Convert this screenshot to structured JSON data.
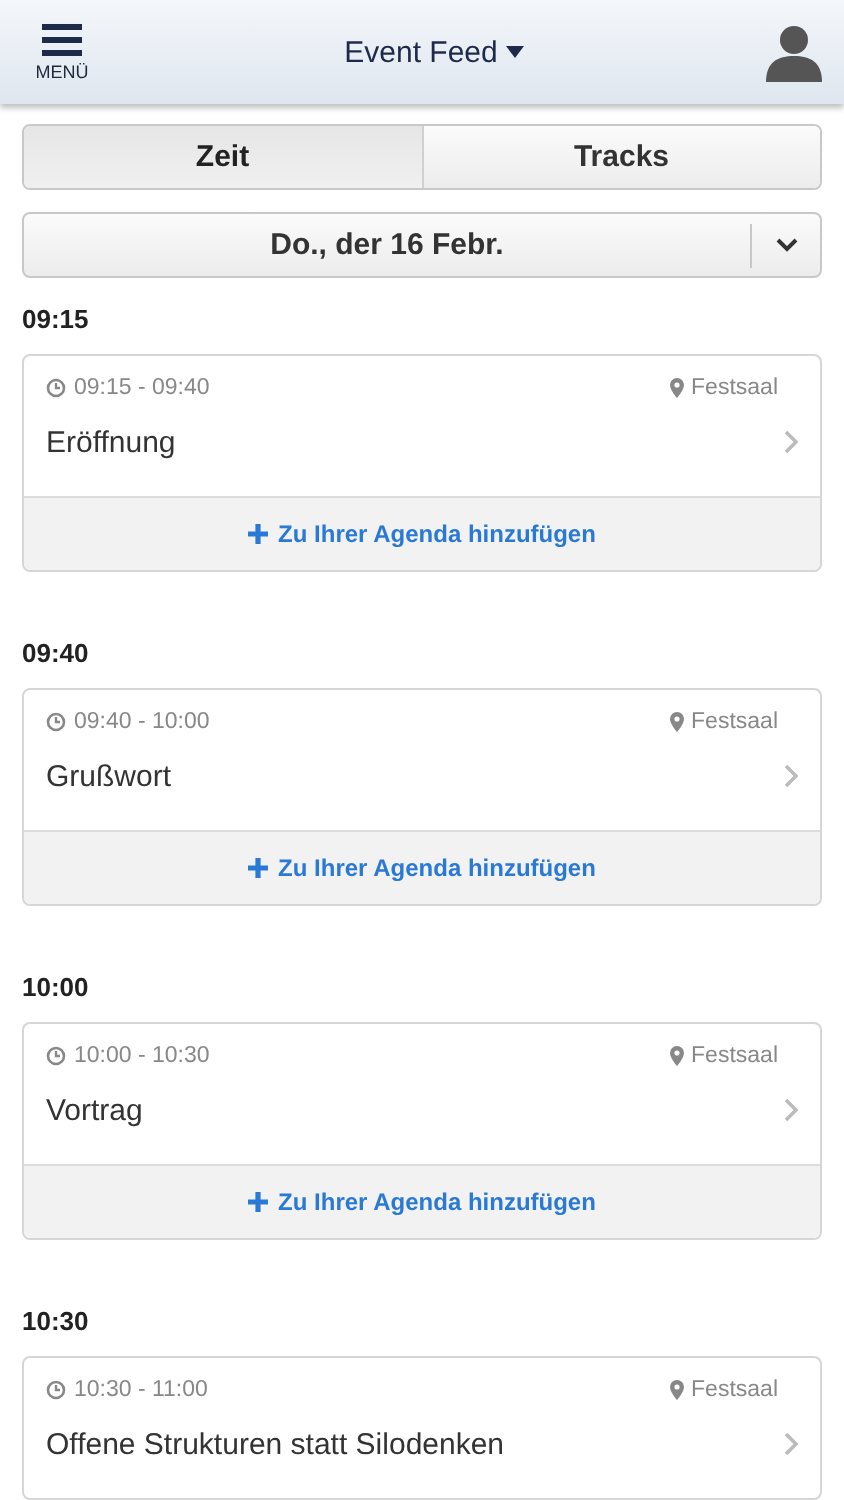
{
  "header": {
    "menu_label": "MENÜ",
    "title": "Event Feed"
  },
  "tabs": [
    {
      "label": "Zeit",
      "selected": true
    },
    {
      "label": "Tracks",
      "selected": false
    }
  ],
  "date_picker": {
    "value": "Do., der 16 Febr."
  },
  "slots": [
    {
      "time": "09:15",
      "sessions": [
        {
          "range": "09:15 - 09:40",
          "room": "Festsaal",
          "title": "Eröffnung",
          "add_label": "Zu Ihrer Agenda hinzufügen"
        }
      ]
    },
    {
      "time": "09:40",
      "sessions": [
        {
          "range": "09:40 - 10:00",
          "room": "Festsaal",
          "title": "Grußwort",
          "add_label": "Zu Ihrer Agenda hinzufügen"
        }
      ]
    },
    {
      "time": "10:00",
      "sessions": [
        {
          "range": "10:00 - 10:30",
          "room": "Festsaal",
          "title": "Vortrag",
          "add_label": "Zu Ihrer Agenda hinzufügen"
        }
      ]
    },
    {
      "time": "10:30",
      "sessions": [
        {
          "range": "10:30 - 11:00",
          "room": "Festsaal",
          "title": "Offene Strukturen statt Silodenken"
        }
      ]
    }
  ]
}
